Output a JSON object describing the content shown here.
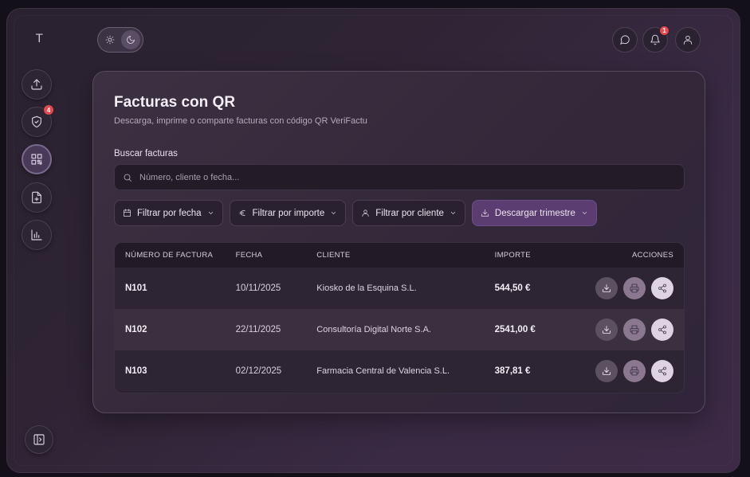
{
  "app": {
    "logo_text": "T"
  },
  "sidebar": {
    "items": [
      {
        "name": "upload",
        "icon": "upload-icon",
        "badge": null
      },
      {
        "name": "verify",
        "icon": "shield-check-icon",
        "badge": "4"
      },
      {
        "name": "qr",
        "icon": "qr-code-icon",
        "badge": null,
        "active": true
      },
      {
        "name": "new-invoice",
        "icon": "file-plus-icon",
        "badge": null
      },
      {
        "name": "reports",
        "icon": "bar-chart-icon",
        "badge": null
      }
    ],
    "collapse_icon": "sidebar-toggle-icon"
  },
  "header": {
    "theme": {
      "light_icon": "sun-icon",
      "dark_icon": "moon-icon",
      "selected": "dark"
    },
    "notifications_badge": "1"
  },
  "page": {
    "title": "Facturas con QR",
    "subtitle": "Descarga, imprime o comparte facturas con código QR VeriFactu",
    "search_label": "Buscar facturas",
    "search_placeholder": "Número, cliente o fecha...",
    "filters": {
      "date": "Filtrar por fecha",
      "amount": "Filtrar por importe",
      "client": "Filtrar por cliente",
      "download": "Descargar trimestre"
    }
  },
  "table": {
    "headers": {
      "number": "NÚMERO DE FACTURA",
      "date": "FECHA",
      "client": "CLIENTE",
      "amount": "IMPORTE",
      "actions": "ACCIONES"
    },
    "rows": [
      {
        "number": "N101",
        "date": "10/11/2025",
        "client": "Kiosko de la Esquina S.L.",
        "amount": "544,50 €"
      },
      {
        "number": "N102",
        "date": "22/11/2025",
        "client": "Consultoría Digital Norte S.A.",
        "amount": "2541,00 €"
      },
      {
        "number": "N103",
        "date": "02/12/2025",
        "client": "Farmacia Central de Valencia S.L.",
        "amount": "387,81 €"
      }
    ]
  },
  "colors": {
    "accent": "#5b3d72",
    "badge": "#e5484d",
    "background": "#2e2434"
  }
}
